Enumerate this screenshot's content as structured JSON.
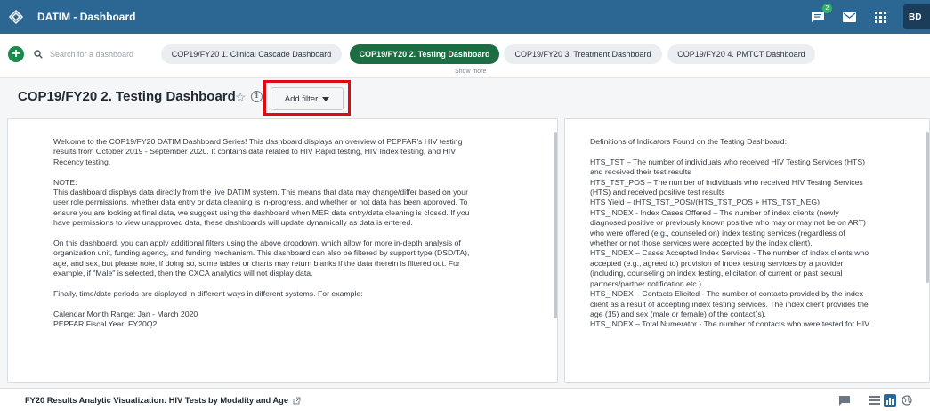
{
  "header": {
    "app_title": "DATIM - Dashboard",
    "message_badge": "2",
    "profile_initials": "BD",
    "bg_color": "#2c6693"
  },
  "dashboard_bar": {
    "search_placeholder": "Search for a dashboard",
    "chips": [
      {
        "label": "COP19/FY20 1. Clinical Cascade Dashboard",
        "active": false
      },
      {
        "label": "COP19/FY20 2. Testing Dashboard",
        "active": true
      },
      {
        "label": "COP19/FY20 3. Treatment Dashboard",
        "active": false
      },
      {
        "label": "COP19/FY20 4. PMTCT Dashboard",
        "active": false
      }
    ],
    "show_more": "Show more"
  },
  "title_row": {
    "title": "COP19/FY20 2. Testing Dashboard",
    "add_filter_label": "Add filter",
    "highlight_color": "#e00a12"
  },
  "left_panel": {
    "text": "Welcome to the COP19/FY20 DATIM Dashboard Series! This dashboard displays an overview of PEPFAR's HIV testing\nresults from October 2019 - September 2020. It contains data related to HIV Rapid testing, HIV Index testing, and HIV\nRecency testing.\n\nNOTE:\nThis dashboard displays data directly from the live DATIM system. This means that data may change/differ based on your\nuser role permissions, whether data entry or data cleaning is in-progress, and whether or not data has been approved. To\nensure you are looking at final data, we suggest using the dashboard when MER data entry/data cleaning is closed. If you\nhave permissions to view unapproved data, these dashboards will update dynamically as data is entered.\n\nOn this dashboard, you can apply additional filters using the above dropdown, which allow for more in-depth analysis of\norganization unit, funding agency, and funding mechanism. This dashboard can also be filtered by support type (DSD/TA),\nage, and sex, but please note, if doing so, some tables or charts may return blanks if the data therein is filtered out. For\nexample, if \"Male\" is selected, then the CXCA analytics will not display data.\n\nFinally, time/date periods are displayed in different ways in different systems. For example:\n\nCalendar Month Range: Jan - March 2020\nPEPFAR Fiscal Year: FY20Q2"
  },
  "right_panel": {
    "text": "Definitions of Indicators Found on the Testing Dashboard:\n\nHTS_TST – The number of individuals who received HIV Testing Services (HTS)\nand received their test results\nHTS_TST_POS – The number of individuals who received HIV Testing Services\n(HTS) and received positive test results\nHTS Yield – (HTS_TST_POS)/(HTS_TST_POS + HTS_TST_NEG)\nHTS_INDEX - Index Cases Offered – The number of index clients (newly\ndiagnosed positive or previously known positive who may or may not be on ART)\nwho were offered (e.g., counseled on) index testing services (regardless of\nwhether or not those services were accepted by the index client).\nHTS_INDEX – Cases Accepted Index Services - The number of index clients who\naccepted (e.g., agreed to) provision of index testing services by a provider\n(including, counseling on index testing, elicitation of current or past sexual\npartners/partner notification etc.).\nHTS_INDEX – Contacts Elicited - The number of contacts provided by the index\nclient as a result of accepting index testing services. The index client provides the\nage (15) and sex (male or female) of the contact(s).\nHTS_INDEX – Total Numerator - The number of contacts who were tested for HIV"
  },
  "bottom": {
    "viz_title": "FY20 Results Analytic Visualization: HIV Tests by Modality and Age"
  }
}
